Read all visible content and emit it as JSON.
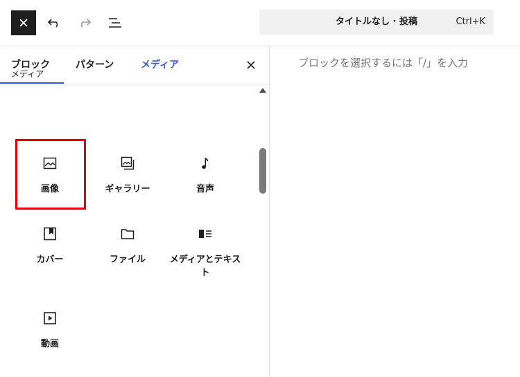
{
  "header": {
    "close_icon": "close-icon",
    "undo_icon": "undo-icon",
    "redo_icon": "redo-icon",
    "list_view_icon": "list-view-icon",
    "command_bar": {
      "title": "タイトルなし · 投稿",
      "shortcut": "Ctrl+K"
    }
  },
  "inserter": {
    "tabs": [
      {
        "label": "ブロック",
        "active": false
      },
      {
        "label": "パターン",
        "active": false
      },
      {
        "label": "メディア",
        "active": true
      }
    ],
    "section_title": "メディア",
    "blocks": [
      {
        "label": "画像",
        "icon": "image-icon",
        "highlighted": true
      },
      {
        "label": "ギャラリー",
        "icon": "gallery-icon"
      },
      {
        "label": "音声",
        "icon": "audio-icon"
      },
      {
        "label": "カバー",
        "icon": "cover-icon"
      },
      {
        "label": "ファイル",
        "icon": "file-icon"
      },
      {
        "label": "メディアとテキスト",
        "icon": "media-text-icon"
      },
      {
        "label": "動画",
        "icon": "video-icon"
      }
    ]
  },
  "editor": {
    "placeholder": "ブロックを選択するには「/」を入力"
  },
  "colors": {
    "accent": "#3858e9",
    "highlight": "#e0000a",
    "dark": "#1e1e1e"
  }
}
